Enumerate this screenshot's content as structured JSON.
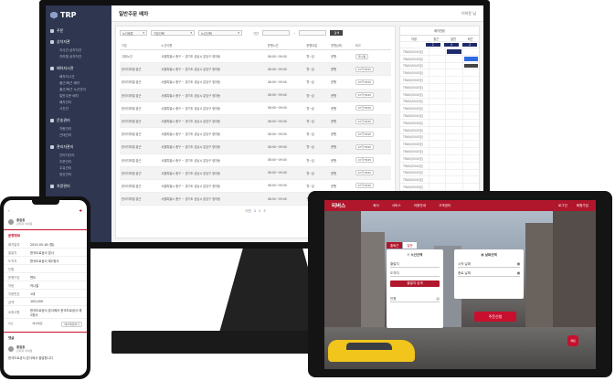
{
  "monitor": {
    "logo_text": "TRP",
    "page_title": "일반주문 배차",
    "user_menu": "이하운 님",
    "sidebar": {
      "sections": [
        {
          "label": "주문",
          "items": []
        },
        {
          "label": "상차지관",
          "items": [
            "지사관 상차지관",
            "지하철 상차지관"
          ]
        },
        {
          "label": "배차지시관",
          "items": [
            "배차지시관",
            "출근/퇴근 배차",
            "출근/퇴근 노선관리",
            "일반주문 배차",
            "배차관리",
            "사진관"
          ]
        },
        {
          "label": "운송관리",
          "items": [
            "차량관리",
            "근태관리"
          ]
        },
        {
          "label": "관리자관리",
          "items": [
            "관리자관리",
            "주문관리",
            "주유관리",
            "정산관리"
          ]
        },
        {
          "label": "차량관리",
          "items": []
        }
      ]
    },
    "filters": {
      "f1": "노선종류",
      "f2": "구분선택",
      "f3": "노선선택",
      "date_label": "기간",
      "search_button": "검색"
    },
    "table": {
      "headers": [
        "구분",
        "노선이름",
        "운행시간",
        "운행요일",
        "운행상태",
        "비고"
      ],
      "rows": [
        [
          "고정노선",
          "서울특별시 중구 ~ 경기도 성남시 분당구 정자동",
          "08:00~09:00",
          "월~금",
          "운행",
          "카니발"
        ],
        [
          "한국지하철 출근",
          "서울특별시 중구 ~ 경기도 성남시 분당구 정자동",
          "08:00~09:00",
          "월~금",
          "운행",
          "07가7845"
        ],
        [
          "한국지하철 출근",
          "서울특별시 중구 ~ 경기도 성남시 분당구 정자동",
          "08:00~09:00",
          "월~금",
          "운행",
          "07가7845"
        ],
        [
          "한국지하철 출근",
          "서울특별시 중구 ~ 경기도 성남시 분당구 정자동",
          "08:00~09:00",
          "월~금",
          "운행",
          "07가7845"
        ],
        [
          "한국지하철 출근",
          "서울특별시 중구 ~ 경기도 성남시 분당구 정자동",
          "08:00~09:00",
          "월~금",
          "운행",
          "07가7845"
        ],
        [
          "한국지하철 출근",
          "서울특별시 중구 ~ 경기도 성남시 분당구 정자동",
          "08:00~09:00",
          "월~금",
          "운행",
          "07가7845"
        ],
        [
          "한국지하철 출근",
          "서울특별시 중구 ~ 경기도 성남시 분당구 정자동",
          "08:00~09:00",
          "월~금",
          "운행",
          "07가7845"
        ],
        [
          "한국지하철 출근",
          "서울특별시 중구 ~ 경기도 성남시 분당구 정자동",
          "08:00~09:00",
          "월~금",
          "운행",
          "07가7845"
        ],
        [
          "한국지하철 출근",
          "서울특별시 중구 ~ 경기도 성남시 분당구 정자동",
          "08:00~09:00",
          "월~금",
          "운행",
          "07가7845"
        ],
        [
          "한국지하철 출근",
          "서울특별시 중구 ~ 경기도 성남시 분당구 정자동",
          "08:00~09:00",
          "월~금",
          "운행",
          "07가7845"
        ],
        [
          "한국지하철 출근",
          "서울특별시 중구 ~ 경기도 성남시 분당구 정자동",
          "08:00~09:00",
          "월~금",
          "운행",
          "07가7845"
        ],
        [
          "한국지하철 출근",
          "서울특별시 중구 ~ 경기도 성남시 분당구 정자동",
          "08:00~09:00",
          "월~금",
          "운행",
          "07가7845"
        ]
      ]
    },
    "pager": {
      "prev": "이전",
      "pages": [
        "1",
        "2",
        "3"
      ]
    },
    "schedule": {
      "title": "배차현황",
      "columns": [
        "차량",
        "출근",
        "일반",
        "퇴근"
      ],
      "column_counts": [
        "",
        "2",
        "3",
        "2"
      ],
      "rows": [
        {
          "label": "TRAN(5045호)",
          "cells": [
            null,
            "#1f2a6b",
            null
          ]
        },
        {
          "label": "TRAN(5045호)",
          "cells": [
            null,
            null,
            "#2f6be0"
          ]
        },
        {
          "label": "TRAN(5045호)",
          "cells": [
            null,
            null,
            "#444444"
          ]
        },
        {
          "label": "TRAN(5045호)",
          "cells": [
            null,
            null,
            null
          ]
        },
        {
          "label": "TRAN(5045호)",
          "cells": [
            null,
            null,
            null
          ]
        },
        {
          "label": "TRAN(5045호)",
          "cells": [
            null,
            null,
            null
          ]
        },
        {
          "label": "TRAN(5045호)",
          "cells": [
            null,
            null,
            null
          ]
        },
        {
          "label": "TRAN(5045호)",
          "cells": [
            null,
            null,
            null
          ]
        },
        {
          "label": "TRAN(5045호)",
          "cells": [
            null,
            null,
            null
          ]
        },
        {
          "label": "TRAN(5045호)",
          "cells": [
            null,
            null,
            null
          ]
        },
        {
          "label": "TRAN(5045호)",
          "cells": [
            null,
            null,
            null
          ]
        },
        {
          "label": "TRAN(5045호)",
          "cells": [
            null,
            null,
            null
          ]
        },
        {
          "label": "TRAN(5045호)",
          "cells": [
            null,
            null,
            null
          ]
        },
        {
          "label": "TRAN(5045호)",
          "cells": [
            null,
            null,
            null
          ]
        },
        {
          "label": "TRAN(5045호)",
          "cells": [
            null,
            null,
            null
          ]
        },
        {
          "label": "TRAN(5045호)",
          "cells": [
            null,
            null,
            null
          ]
        },
        {
          "label": "TRAN(5045호)",
          "cells": [
            null,
            null,
            null
          ]
        },
        {
          "label": "TRAN(5045호)",
          "cells": [
            null,
            null,
            null
          ]
        },
        {
          "label": "TRAN(5045호)",
          "cells": [
            null,
            null,
            null
          ]
        },
        {
          "label": "TRAN(5045호)",
          "cells": [
            null,
            null,
            null
          ]
        },
        {
          "label": "TRAN(5045호)",
          "cells": [
            null,
            null,
            null
          ]
        },
        {
          "label": "TRAN(5045호)",
          "cells": [
            null,
            null,
            null
          ]
        },
        {
          "label": "TRAN(5045호)",
          "cells": [
            null,
            null,
            null
          ]
        },
        {
          "label": "TRAN(5045호)",
          "cells": [
            null,
            null,
            null
          ]
        }
      ]
    }
  },
  "phone": {
    "back": "‹",
    "profile_name": "홍길동",
    "profile_sub": "관리자 이하운",
    "section": "운행정보",
    "rows": [
      {
        "k": "배차일자",
        "v": "2020.05.18 (월)"
      },
      {
        "k": "출발지",
        "v": "한국도로공사 본사"
      },
      {
        "k": "도착지",
        "v": "한국도로공사 제2청사"
      },
      {
        "k": "인원",
        "v": ""
      },
      {
        "k": "운행구분",
        "v": "편도"
      },
      {
        "k": "차량",
        "v": "카니발"
      },
      {
        "k": "차량번호",
        "v": "1대"
      },
      {
        "k": "금액",
        "v": "100,000"
      },
      {
        "k": "요청사항",
        "v": "한국도로공사 본사에서 한국도로공사 제2청사"
      }
    ],
    "actions": {
      "left": "취소",
      "mid": "배차확정",
      "right": "배차확정하기"
    },
    "comment_label": "댓글",
    "comment_name": "홍길동",
    "comment_sub": "관리자 이하운",
    "comment_text": "한국도로공사 본사에서 출발합니다"
  },
  "tablet": {
    "logo": "티버스",
    "menu": [
      "회사",
      "서비스",
      "이용안내",
      "고객센터"
    ],
    "right_menu": [
      "로그인",
      "회원가입"
    ],
    "tabs": [
      "출퇴근",
      "일반"
    ],
    "left_panel": {
      "title": "노선선택",
      "field1": "출발지",
      "field2": "도착지",
      "button": "출발지 검색",
      "field3": "인원"
    },
    "right_panel": {
      "title": "날짜선택",
      "field1": "시작 날짜",
      "field2": "종료 날짜"
    },
    "cta": "주문신청",
    "chat": "채팅"
  }
}
